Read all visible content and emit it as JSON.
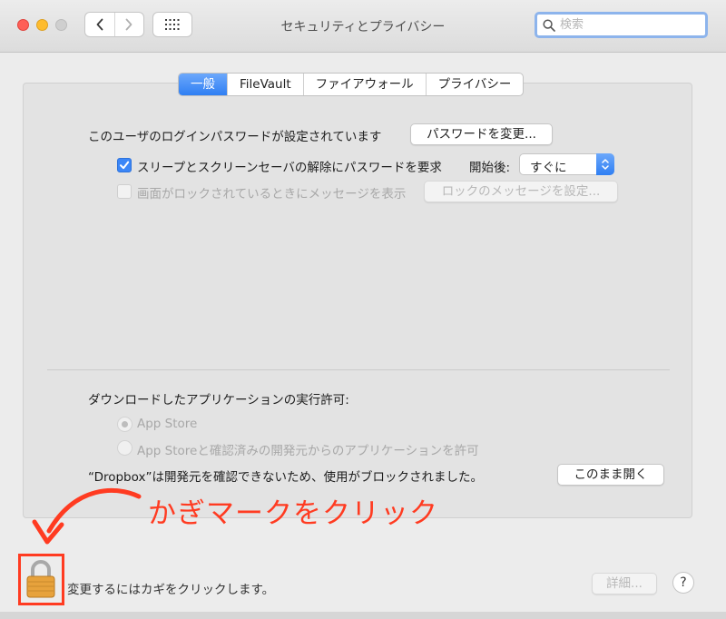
{
  "window": {
    "title": "セキュリティとプライバシー",
    "search_placeholder": "検索"
  },
  "tabs": [
    {
      "label": "一般",
      "active": true
    },
    {
      "label": "FileVault",
      "active": false
    },
    {
      "label": "ファイアウォール",
      "active": false
    },
    {
      "label": "プライバシー",
      "active": false
    }
  ],
  "general": {
    "password_text": "このユーザのログインパスワードが設定されています",
    "change_password_button": "パスワードを変更...",
    "require_password_label": "スリープとスクリーンセーバの解除にパスワードを要求",
    "require_password_checked": true,
    "start_after_label": "開始後:",
    "start_after_value": "すぐに",
    "lock_message_label": "画面がロックされているときにメッセージを表示",
    "lock_message_checked": false,
    "lock_message_button": "ロックのメッセージを設定..."
  },
  "download": {
    "heading": "ダウンロードしたアプリケーションの実行許可:",
    "option_app_store": "App Store",
    "option_identified": "App Storeと確認済みの開発元からのアプリケーションを許可",
    "selected_option": "App Store",
    "blocked_message": "“Dropbox”は開発元を確認できないため、使用がブロックされました。",
    "open_anyway_button": "このまま開く"
  },
  "annotation": {
    "text": "かぎマークをクリック",
    "color": "#ff3b21"
  },
  "footer": {
    "lock_text": "変更するにはカギをクリックします。",
    "advanced_button": "詳細...",
    "help_label": "?"
  },
  "colors": {
    "accent": "#2f7ff3",
    "close": "#fe5f57",
    "minimize": "#febc2e"
  }
}
